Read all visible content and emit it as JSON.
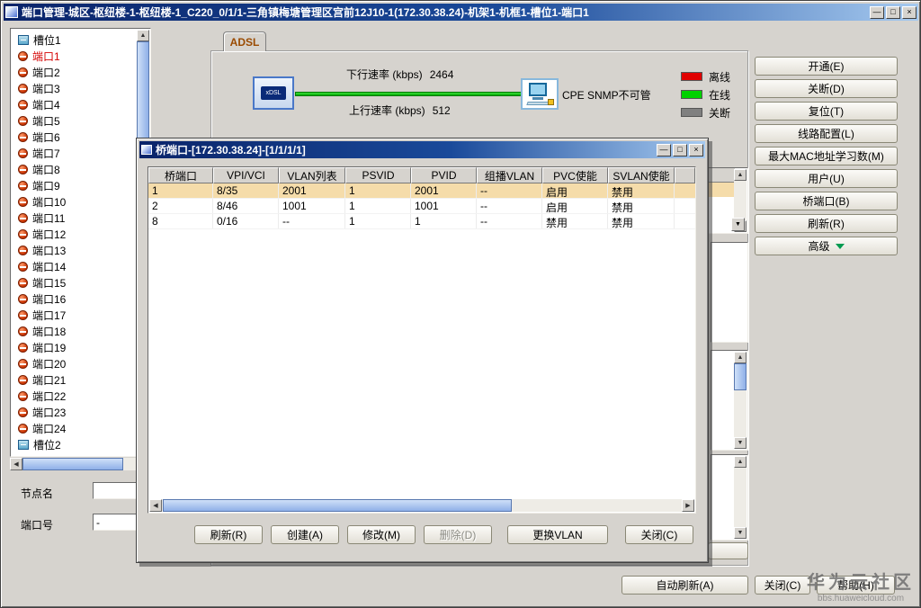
{
  "window": {
    "title": "端口管理-城区-枢纽楼-1-枢纽楼-1_C220_0/1/1-三角镇梅塘管理区宫前12J10-1(172.30.38.24)-机架1-机框1-槽位1-端口1",
    "controls": {
      "minimize": "—",
      "maximize": "□",
      "close": "×"
    }
  },
  "tree": {
    "items": [
      {
        "label": "槽位1",
        "type": "slot"
      },
      {
        "label": "端口1",
        "type": "port",
        "selected": true
      },
      {
        "label": "端口2",
        "type": "port"
      },
      {
        "label": "端口3",
        "type": "port"
      },
      {
        "label": "端口4",
        "type": "port"
      },
      {
        "label": "端口5",
        "type": "port"
      },
      {
        "label": "端口6",
        "type": "port"
      },
      {
        "label": "端口7",
        "type": "port"
      },
      {
        "label": "端口8",
        "type": "port"
      },
      {
        "label": "端口9",
        "type": "port"
      },
      {
        "label": "端口10",
        "type": "port"
      },
      {
        "label": "端口11",
        "type": "port"
      },
      {
        "label": "端口12",
        "type": "port"
      },
      {
        "label": "端口13",
        "type": "port"
      },
      {
        "label": "端口14",
        "type": "port"
      },
      {
        "label": "端口15",
        "type": "port"
      },
      {
        "label": "端口16",
        "type": "port"
      },
      {
        "label": "端口17",
        "type": "port"
      },
      {
        "label": "端口18",
        "type": "port"
      },
      {
        "label": "端口19",
        "type": "port"
      },
      {
        "label": "端口20",
        "type": "port"
      },
      {
        "label": "端口21",
        "type": "port"
      },
      {
        "label": "端口22",
        "type": "port"
      },
      {
        "label": "端口23",
        "type": "port"
      },
      {
        "label": "端口24",
        "type": "port"
      },
      {
        "label": "槽位2",
        "type": "slot"
      }
    ]
  },
  "left_fields": {
    "node_name_label": "节点名",
    "node_name_value": "",
    "port_no_label": "端口号",
    "port_no_value": "-"
  },
  "tabs": {
    "active": "ADSL"
  },
  "diagram": {
    "device_label": "xDSL",
    "downstream_label": "下行速率 (kbps)",
    "downstream_value": "2464",
    "upstream_label": "上行速率 (kbps)",
    "upstream_value": "512",
    "cpe_status": "CPE SNMP不可管",
    "legend": [
      {
        "label": "离线",
        "color": "#e00000"
      },
      {
        "label": "在线",
        "color": "#00d200"
      },
      {
        "label": "关断",
        "color": "#808080"
      }
    ]
  },
  "right_buttons": [
    {
      "label": "开通(E)",
      "name": "open-button"
    },
    {
      "label": "关断(D)",
      "name": "shutdown-button"
    },
    {
      "label": "复位(T)",
      "name": "reset-button"
    },
    {
      "label": "线路配置(L)",
      "name": "line-config-button"
    },
    {
      "label": "最大MAC地址学习数(M)",
      "name": "max-mac-learning-button"
    },
    {
      "label": "用户(U)",
      "name": "user-button"
    },
    {
      "label": "桥端口(B)",
      "name": "bridge-port-button"
    },
    {
      "label": "刷新(R)",
      "name": "refresh-button"
    },
    {
      "label": "高级",
      "name": "advanced-button",
      "has_dropdown": true
    }
  ],
  "dialog": {
    "title": "桥端口-[172.30.38.24]-[1/1/1/1]",
    "table": {
      "columns": [
        "桥端口",
        "VPI/VCI",
        "VLAN列表",
        "PSVID",
        "PVID",
        "组播VLAN",
        "PVC使能",
        "SVLAN使能"
      ],
      "rows": [
        {
          "cells": [
            "1",
            "8/35",
            "2001",
            "1",
            "2001",
            "--",
            "启用",
            "禁用"
          ],
          "selected": true
        },
        {
          "cells": [
            "2",
            "8/46",
            "1001",
            "1",
            "1001",
            "--",
            "启用",
            "禁用"
          ],
          "selected": false
        },
        {
          "cells": [
            "8",
            "0/16",
            "--",
            "1",
            "1",
            "--",
            "禁用",
            "禁用"
          ],
          "selected": false
        }
      ]
    },
    "buttons": [
      {
        "label": "刷新(R)",
        "name": "dialog-refresh-button"
      },
      {
        "label": "创建(A)",
        "name": "dialog-create-button"
      },
      {
        "label": "修改(M)",
        "name": "dialog-modify-button"
      },
      {
        "label": "删除(D)",
        "name": "dialog-delete-button",
        "disabled": true
      },
      {
        "label": "更换VLAN",
        "name": "dialog-change-vlan-button"
      },
      {
        "label": "关闭(C)",
        "name": "dialog-close-button"
      }
    ]
  },
  "bottom_buttons": [
    {
      "label": "自动刷新(A)",
      "name": "auto-refresh-button"
    },
    {
      "label": "关闭(C)",
      "name": "main-close-button"
    },
    {
      "label": "帮助(H)",
      "name": "help-button"
    }
  ],
  "watermark": {
    "line1": "华为云社区",
    "line2": "bbs.huaweicloud.com"
  }
}
